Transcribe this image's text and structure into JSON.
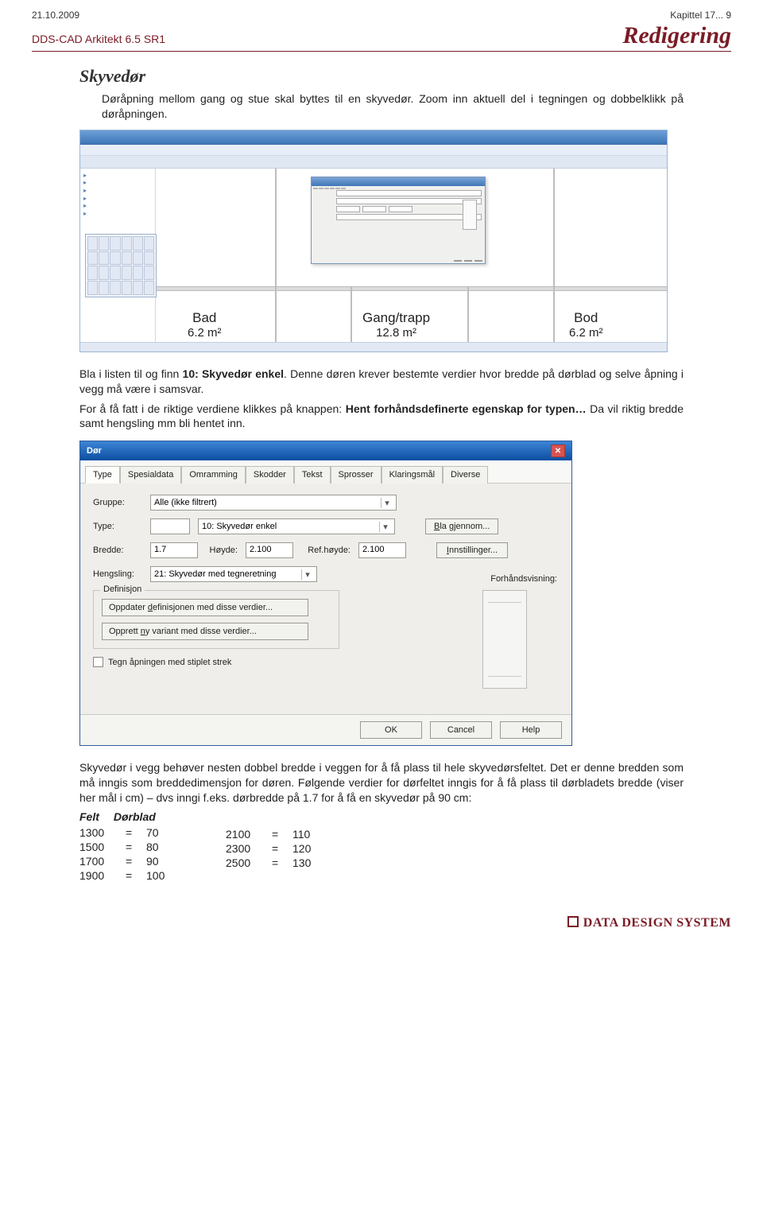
{
  "header": {
    "date": "21.10.2009",
    "chapter_ref": "Kapittel 17... 9",
    "product": "DDS-CAD Arkitekt  6.5 SR1",
    "chapter_title": "Redigering"
  },
  "section_title": "Skyvedør",
  "para1": "Døråpning mellom gang og stue skal byttes til en skyvedør. Zoom inn aktuell del i tegningen og dobbelklikk på døråpningen.",
  "rooms": {
    "bad": {
      "name": "Bad",
      "area": "6.2 m²"
    },
    "gang": {
      "name": "Gang/trapp",
      "area": "12.8 m²"
    },
    "bod": {
      "name": "Bod",
      "area": "6.2 m²"
    }
  },
  "para2_a": "Bla i listen til og finn ",
  "para2_b": "10: Skyvedør enkel",
  "para2_c": ". Denne døren krever bestemte verdier hvor bredde på dørblad og selve åpning i vegg må være i samsvar.",
  "para3_a": "For å få fatt i de riktige verdiene klikkes på knappen: ",
  "para3_b": "Hent forhåndsdefinerte egenskap for typen…",
  "para3_c": " Da vil riktig bredde samt hengsling mm bli hentet inn.",
  "dialog": {
    "title": "Dør",
    "tabs": [
      "Type",
      "Spesialdata",
      "Omramming",
      "Skodder",
      "Tekst",
      "Sprosser",
      "Klaringsmål",
      "Diverse"
    ],
    "gruppe_label": "Gruppe:",
    "gruppe_value": "Alle (ikke filtrert)",
    "type_label": "Type:",
    "type_value": "10:  Skyvedør enkel",
    "bla_btn": "Bla gjennom...",
    "bredde_label": "Bredde:",
    "bredde_value": "1.7",
    "hoyde_label": "Høyde:",
    "hoyde_value": "2.100",
    "refh_label": "Ref.høyde:",
    "refh_value": "2.100",
    "innst_btn": "Innstillinger...",
    "hengsling_label": "Hengsling:",
    "hengsling_value": "21: Skyvedør med tegneretning",
    "preview_label": "Forhåndsvisning:",
    "def_legend": "Definisjon",
    "def_btn1": "Oppdater definisjonen med disse verdier...",
    "def_btn2": "Opprett ny variant med disse verdier...",
    "chk_label": "Tegn åpningen med stiplet strek",
    "ok": "OK",
    "cancel": "Cancel",
    "help": "Help"
  },
  "para4": "Skyvedør i vegg behøver nesten dobbel bredde i veggen for å få plass til hele skyvedørsfeltet. Det er denne bredden som må inngis som breddedimensjon for døren. Følgende verdier for dørfeltet inngis for å få plass til dørbladets bredde (viser her mål i cm) – dvs inngi f.eks. dørbredde på 1.7 for å få en skyvedør på 90 cm:",
  "fd": {
    "h1": "Felt",
    "h2": "Dørblad",
    "left": [
      {
        "a": "1300",
        "b": "70"
      },
      {
        "a": "1500",
        "b": "80"
      },
      {
        "a": "1700",
        "b": "90"
      },
      {
        "a": "1900",
        "b": "100"
      }
    ],
    "right": [
      {
        "a": "2100",
        "b": "110"
      },
      {
        "a": "2300",
        "b": "120"
      },
      {
        "a": "2500",
        "b": "130"
      }
    ]
  },
  "footer_logo": "DATA DESIGN SYSTEM"
}
